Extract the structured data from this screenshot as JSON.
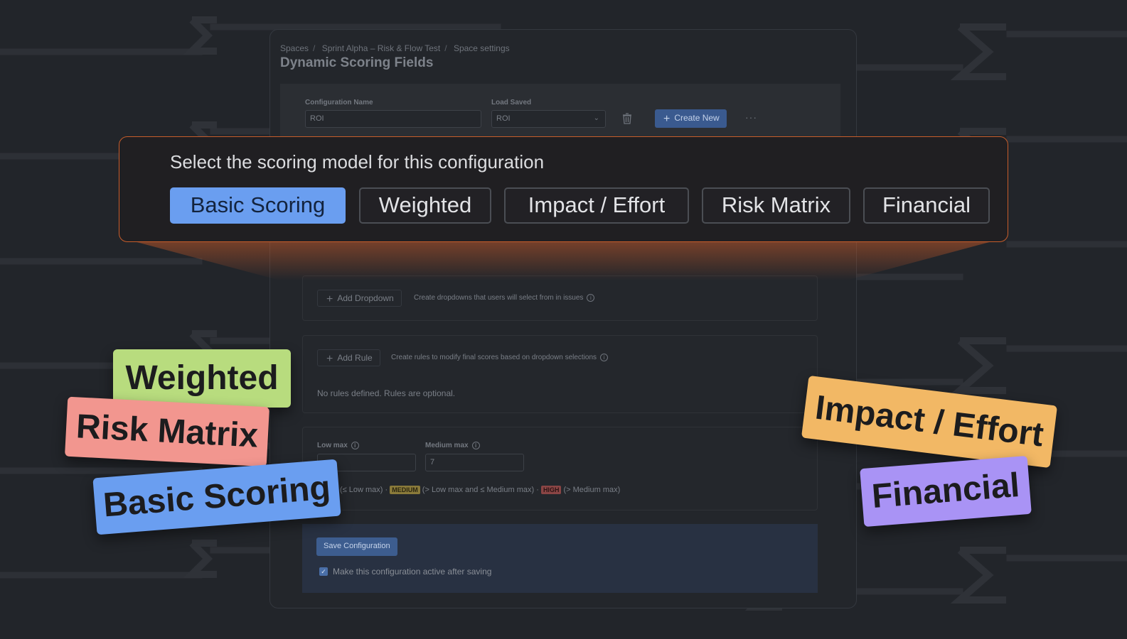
{
  "breadcrumb": [
    "Spaces",
    "Sprint Alpha – Risk & Flow Test",
    "Space settings"
  ],
  "page_title": "Dynamic Scoring Fields",
  "config": {
    "name_label": "Configuration Name",
    "name_value": "ROI",
    "load_label": "Load Saved",
    "load_value": "ROI",
    "create_label": "Create New",
    "more_label": "···"
  },
  "dropdowns": {
    "add_label": "Add Dropdown",
    "hint": "Create dropdowns that users will select from in issues"
  },
  "rules": {
    "add_label": "Add Rule",
    "hint": "Create rules to modify final scores based on dropdown selections",
    "empty": "No rules defined. Rules are optional."
  },
  "thresholds": {
    "low_label": "Low max",
    "low_value": "",
    "medium_label": "Medium max",
    "medium_value": "7",
    "low_desc": "(≤ Low max)",
    "medium_badge": "MEDIUM",
    "medium_desc": "(> Low max and ≤ Medium max)",
    "high_badge": "HIGH",
    "high_desc": "(> Medium max)",
    "dot": "·"
  },
  "save": {
    "button_label": "Save Configuration",
    "checkbox_label": "Make this configuration active after saving",
    "checked": true
  },
  "overlay": {
    "title": "Select the scoring model for this configuration",
    "models": [
      "Basic Scoring",
      "Weighted",
      "Impact / Effort",
      "Risk Matrix",
      "Financial"
    ],
    "selected": "Basic Scoring"
  },
  "tags": {
    "weighted": "Weighted",
    "risk_matrix": "Risk Matrix",
    "basic_scoring": "Basic Scoring",
    "impact_effort": "Impact / Effort",
    "financial": "Financial"
  },
  "colors": {
    "accent": "#6a9ef0",
    "overlay_border": "#c75d2b",
    "tag_weighted": "#b8dc7e",
    "tag_risk": "#f2968f",
    "tag_basic": "#6a9ef0",
    "tag_impact": "#f2b865",
    "tag_financial": "#a993f5"
  }
}
